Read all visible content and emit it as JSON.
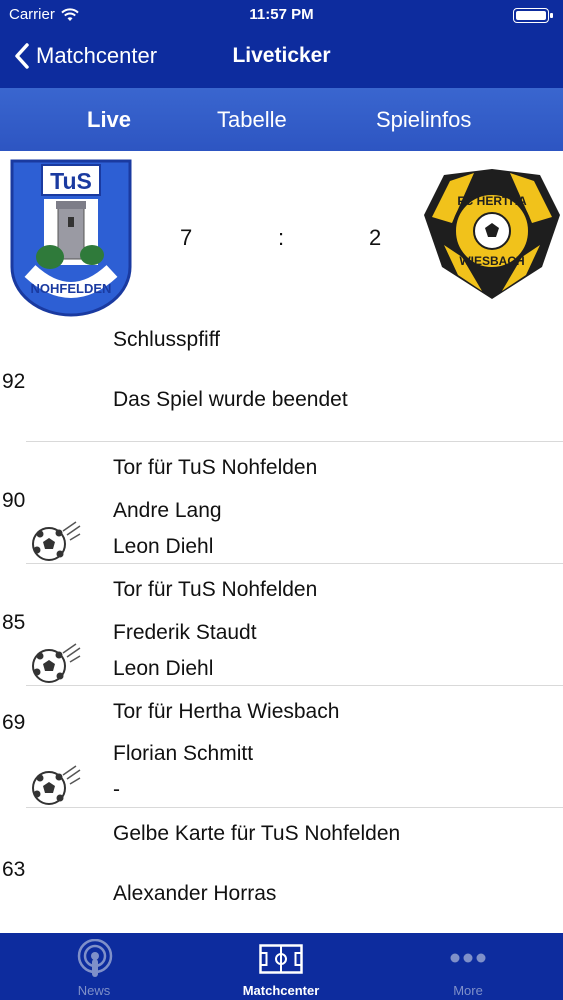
{
  "status_bar": {
    "carrier": "Carrier",
    "time": "11:57 PM"
  },
  "nav": {
    "back_label": "Matchcenter",
    "title": "Liveticker"
  },
  "segments": [
    {
      "label": "Live",
      "active": true
    },
    {
      "label": "Tabelle",
      "active": false
    },
    {
      "label": "Spielinfos",
      "active": false
    }
  ],
  "match": {
    "home_score": "7",
    "separator": ":",
    "away_score": "2",
    "home_crest_text": "TuS NOHFELDEN",
    "away_crest_text": "FC HERTHA WIESBACH"
  },
  "events": [
    {
      "minute": "92",
      "lines": [
        "Schlusspfiff",
        "Das Spiel wurde beendet"
      ],
      "icon": "whistle"
    },
    {
      "minute": "90",
      "lines": [
        "Tor für TuS Nohfelden",
        "Andre Lang",
        "Leon Diehl"
      ],
      "icon": "soccer-ball-icon"
    },
    {
      "minute": "85",
      "lines": [
        "Tor für TuS Nohfelden",
        "Frederik Staudt",
        "Leon Diehl"
      ],
      "icon": "soccer-ball-icon"
    },
    {
      "minute": "69",
      "lines": [
        "Tor für Hertha Wiesbach",
        "Florian Schmitt",
        "-"
      ],
      "icon": "soccer-ball-icon"
    },
    {
      "minute": "63",
      "lines": [
        "Gelbe Karte für TuS Nohfelden",
        "Alexander Horras"
      ],
      "icon": "yellow-card"
    }
  ],
  "tabbar": [
    {
      "label": "News",
      "icon": "broadcast-icon",
      "active": false
    },
    {
      "label": "Matchcenter",
      "icon": "pitch-icon",
      "active": true
    },
    {
      "label": "More",
      "icon": "more-dots-icon",
      "active": false
    }
  ],
  "colors": {
    "nav_bg": "#0d2c9e",
    "segment_bg": "#3a66cf",
    "tab_inactive": "#7f90c9"
  }
}
